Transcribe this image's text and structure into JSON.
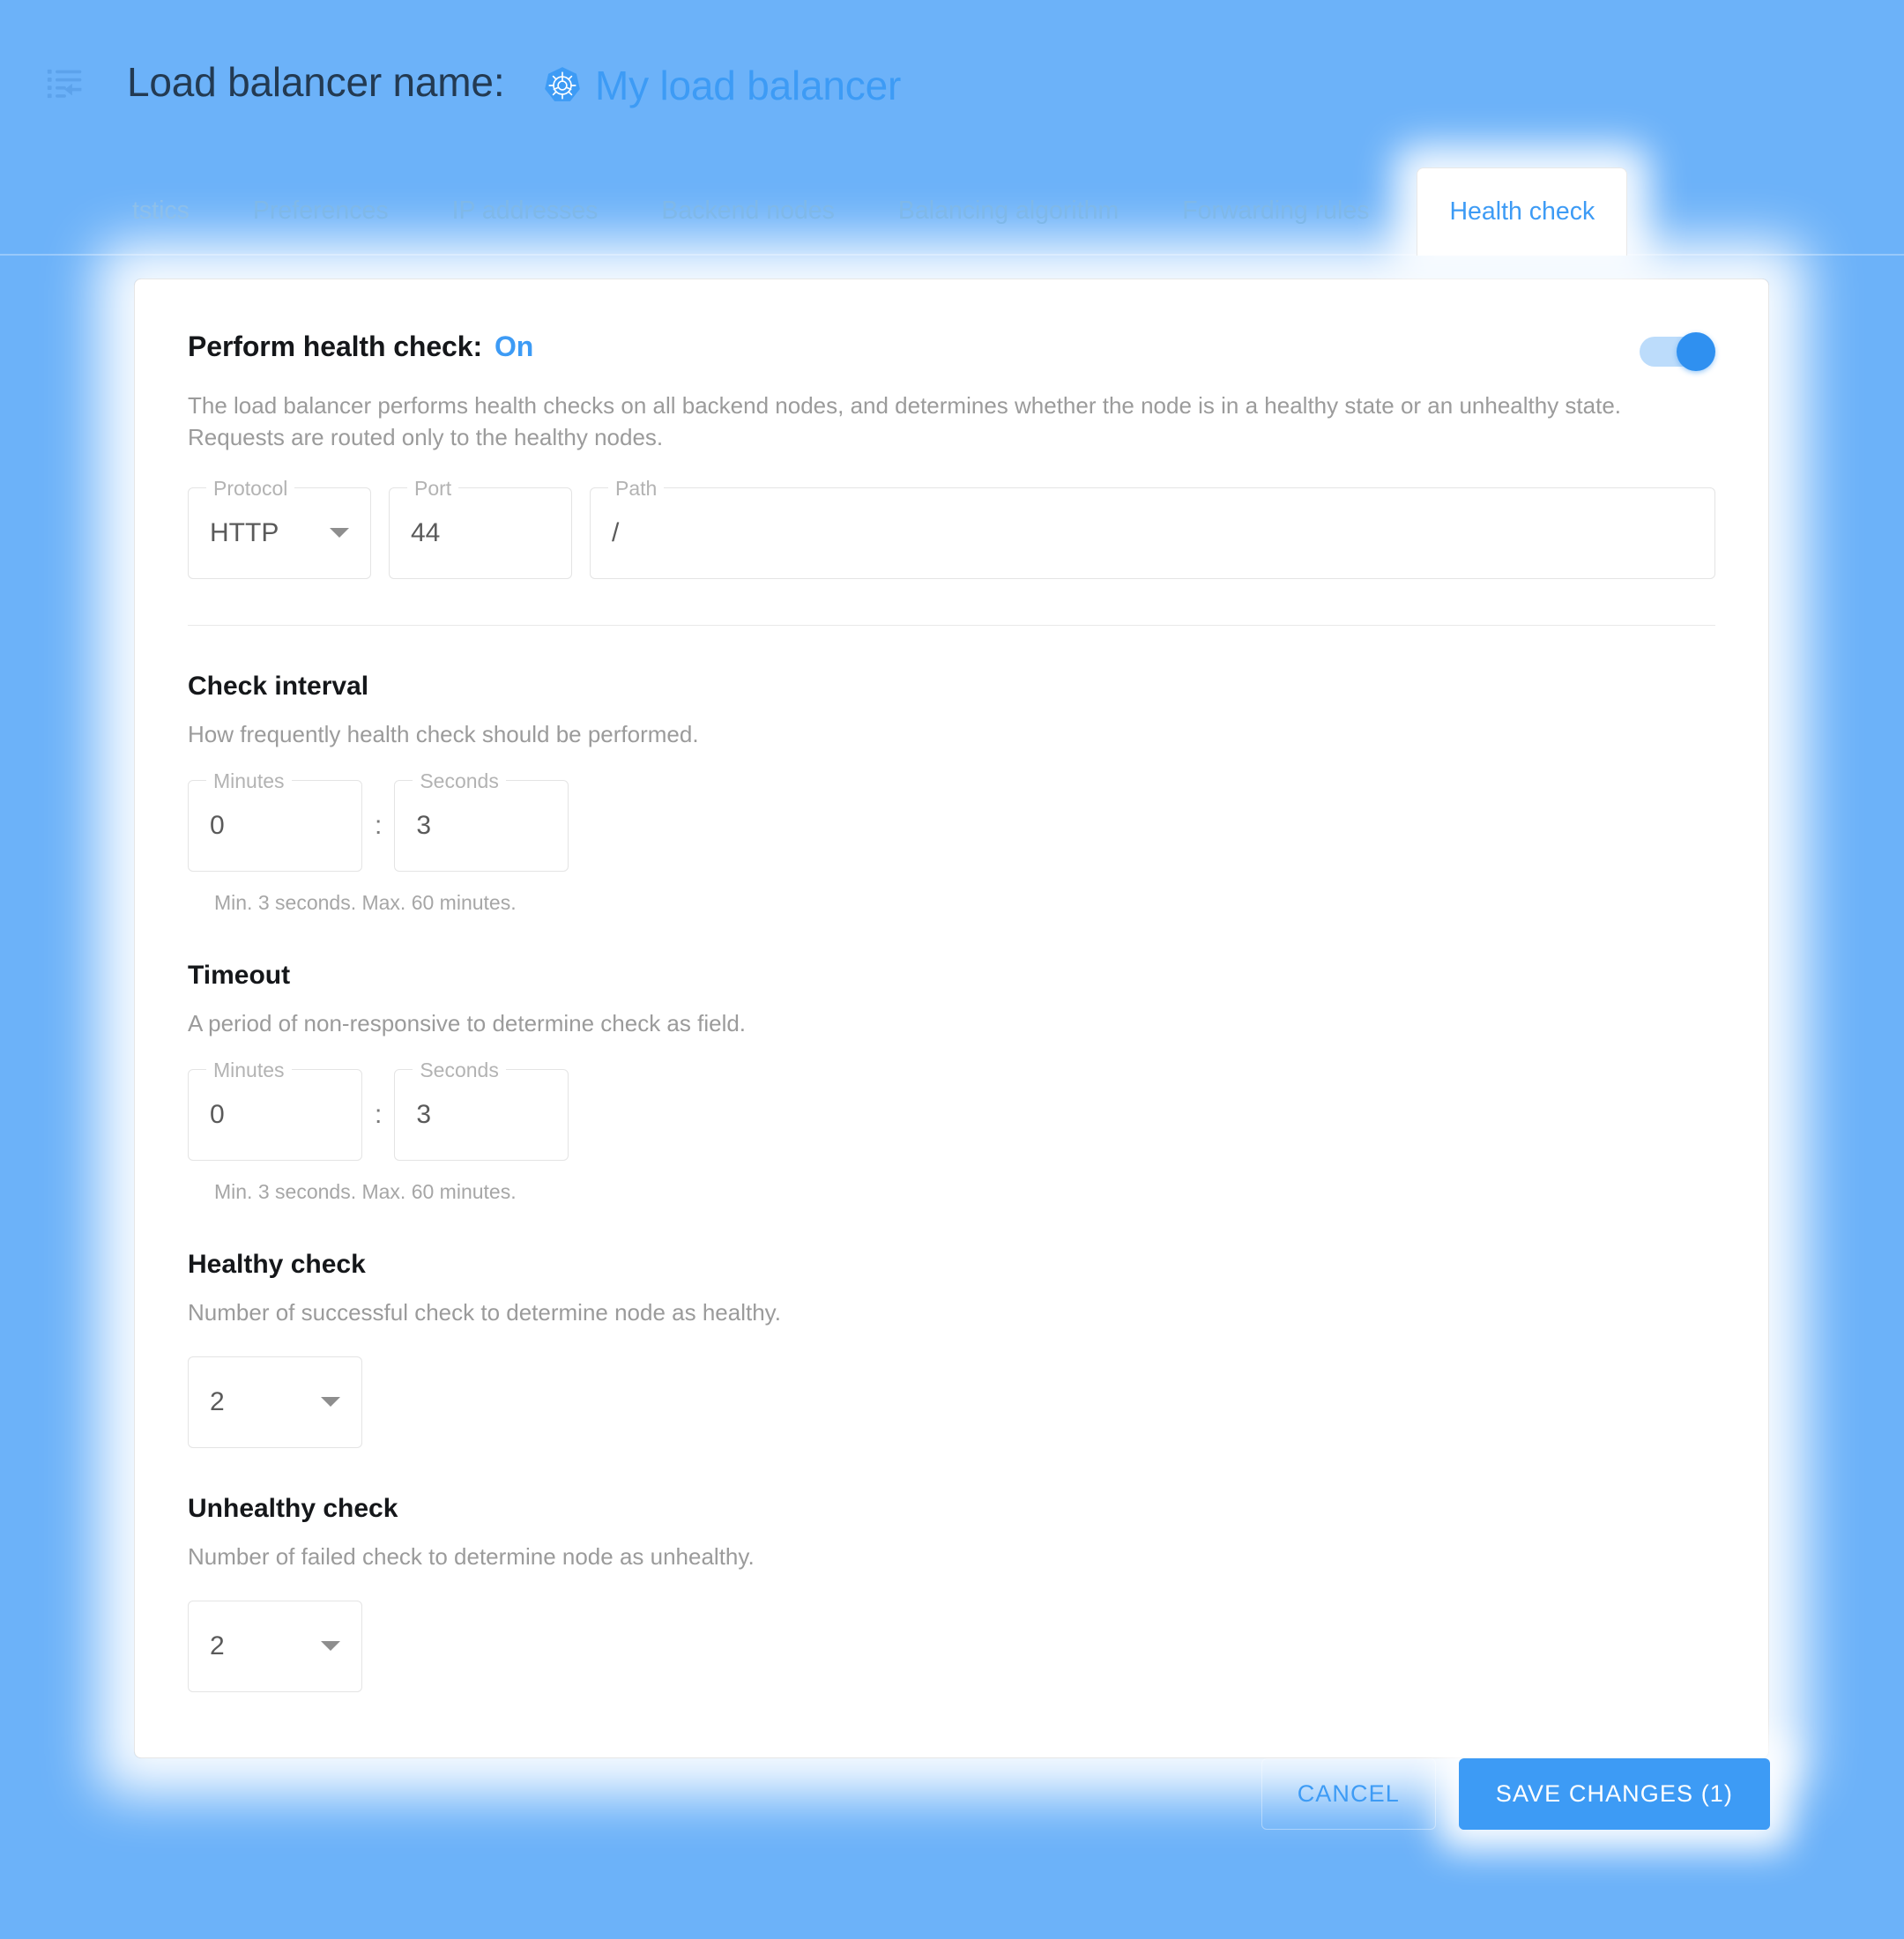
{
  "header": {
    "collapse_icon": "list-collapse-icon",
    "title_label": "Load balancer name:",
    "lb_icon": "kubernetes-icon",
    "lb_name": "My load balancer"
  },
  "tabs": [
    {
      "label": "tstics",
      "active": false,
      "clipped": true
    },
    {
      "label": "Preferences",
      "active": false
    },
    {
      "label": "IP addresses",
      "active": false
    },
    {
      "label": "Backend nodes",
      "active": false
    },
    {
      "label": "Balancing algorithm",
      "active": false
    },
    {
      "label": "Forwarding rules",
      "active": false
    },
    {
      "label": "Health check",
      "active": true
    }
  ],
  "perform": {
    "title": "Perform health check:",
    "state": "On",
    "toggle_on": true,
    "description": "The load balancer performs health checks on all backend nodes, and determines whether the node is in a healthy state or an unhealthy state. Requests are routed only to the healthy nodes.",
    "protocol": {
      "legend": "Protocol",
      "value": "HTTP",
      "caret_icon": "chevron-down-icon"
    },
    "port": {
      "legend": "Port",
      "value": "44"
    },
    "path": {
      "legend": "Path",
      "value": "/"
    }
  },
  "check_interval": {
    "title": "Check interval",
    "description": "How frequently health check should be performed.",
    "minutes_legend": "Minutes",
    "minutes_value": "0",
    "separator": ":",
    "seconds_legend": "Seconds",
    "seconds_value": "3",
    "hint": "Min. 3 seconds. Max. 60 minutes."
  },
  "timeout": {
    "title": "Timeout",
    "description": "A period of non-responsive to determine check as field.",
    "minutes_legend": "Minutes",
    "minutes_value": "0",
    "separator": ":",
    "seconds_legend": "Seconds",
    "seconds_value": "3",
    "hint": "Min. 3 seconds. Max. 60 minutes."
  },
  "healthy_check": {
    "title": "Healthy check",
    "description": "Number of successful check to determine node as healthy.",
    "value": "2",
    "caret_icon": "chevron-down-icon"
  },
  "unhealthy_check": {
    "title": "Unhealthy check",
    "description": "Number of failed check to determine node as unhealthy.",
    "value": "2",
    "caret_icon": "chevron-down-icon"
  },
  "footer": {
    "cancel_label": "CANCEL",
    "save_label": "SAVE CHANGES (1)"
  },
  "colors": {
    "background": "#6cb2f9",
    "accent": "#3d9bf5",
    "title_text": "#233a52",
    "muted_text": "#9b9b9b",
    "card_bg": "#ffffff"
  }
}
